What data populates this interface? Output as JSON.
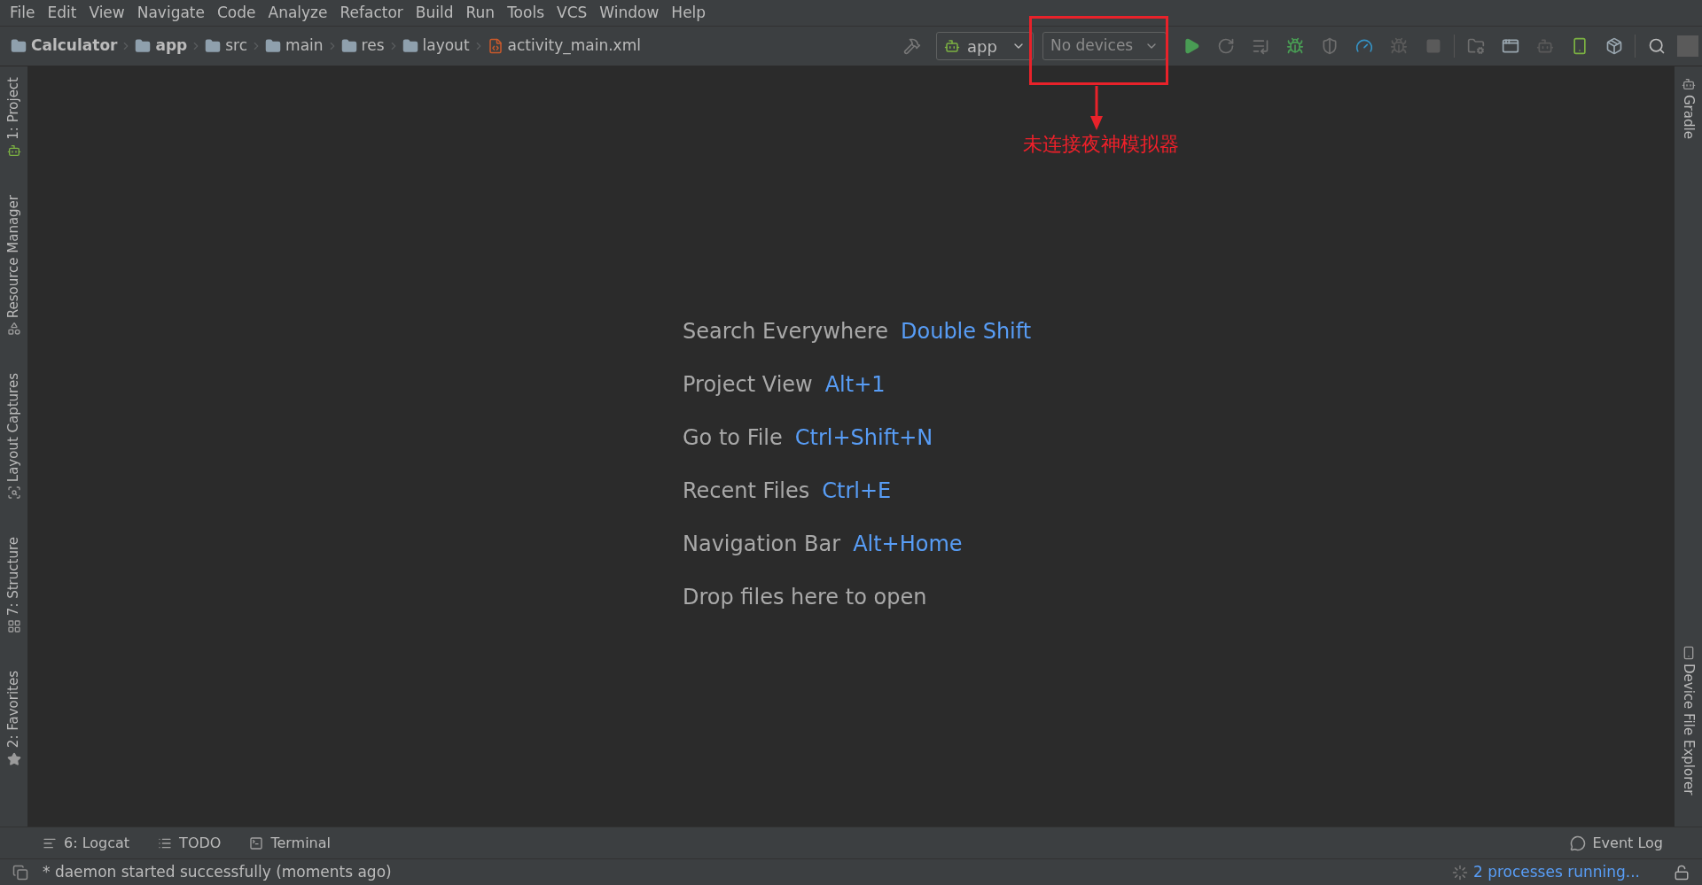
{
  "menu": [
    "File",
    "Edit",
    "View",
    "Navigate",
    "Code",
    "Analyze",
    "Refactor",
    "Build",
    "Run",
    "Tools",
    "VCS",
    "Window",
    "Help"
  ],
  "breadcrumbs": [
    {
      "label": "Calculator",
      "kind": "module"
    },
    {
      "label": "app",
      "kind": "module"
    },
    {
      "label": "src",
      "kind": "folder"
    },
    {
      "label": "main",
      "kind": "folder"
    },
    {
      "label": "res",
      "kind": "res"
    },
    {
      "label": "layout",
      "kind": "layout"
    },
    {
      "label": "activity_main.xml",
      "kind": "file"
    }
  ],
  "run_config": {
    "label": "app"
  },
  "device_selector": {
    "placeholder": "No devices",
    "disabled": true
  },
  "annotation": {
    "text": "未连接夜神模拟器"
  },
  "left_tools": [
    {
      "label": "1: Project",
      "kind": "project"
    },
    {
      "label": "Resource Manager",
      "kind": "resources"
    },
    {
      "label": "Layout Captures",
      "kind": "captures"
    },
    {
      "label": "7: Structure",
      "kind": "structure"
    },
    {
      "label": "2: Favorites",
      "kind": "favorites"
    }
  ],
  "right_tools": [
    {
      "label": "Gradle",
      "kind": "gradle"
    },
    {
      "label": "Device File Explorer",
      "kind": "device"
    }
  ],
  "hints": [
    {
      "label": "Search Everywhere",
      "shortcut": "Double Shift"
    },
    {
      "label": "Project View",
      "shortcut": "Alt+1"
    },
    {
      "label": "Go to File",
      "shortcut": "Ctrl+Shift+N"
    },
    {
      "label": "Recent Files",
      "shortcut": "Ctrl+E"
    },
    {
      "label": "Navigation Bar",
      "shortcut": "Alt+Home"
    },
    {
      "label": "Drop files here to open"
    }
  ],
  "bottom_tools": [
    {
      "label": "6: Logcat",
      "kind": "logcat"
    },
    {
      "label": "TODO",
      "kind": "todo"
    },
    {
      "label": "Terminal",
      "kind": "terminal"
    }
  ],
  "event_log": {
    "label": "Event Log"
  },
  "status_bar": {
    "message": "* daemon started successfully (moments ago)",
    "processes": "2 processes running..."
  }
}
